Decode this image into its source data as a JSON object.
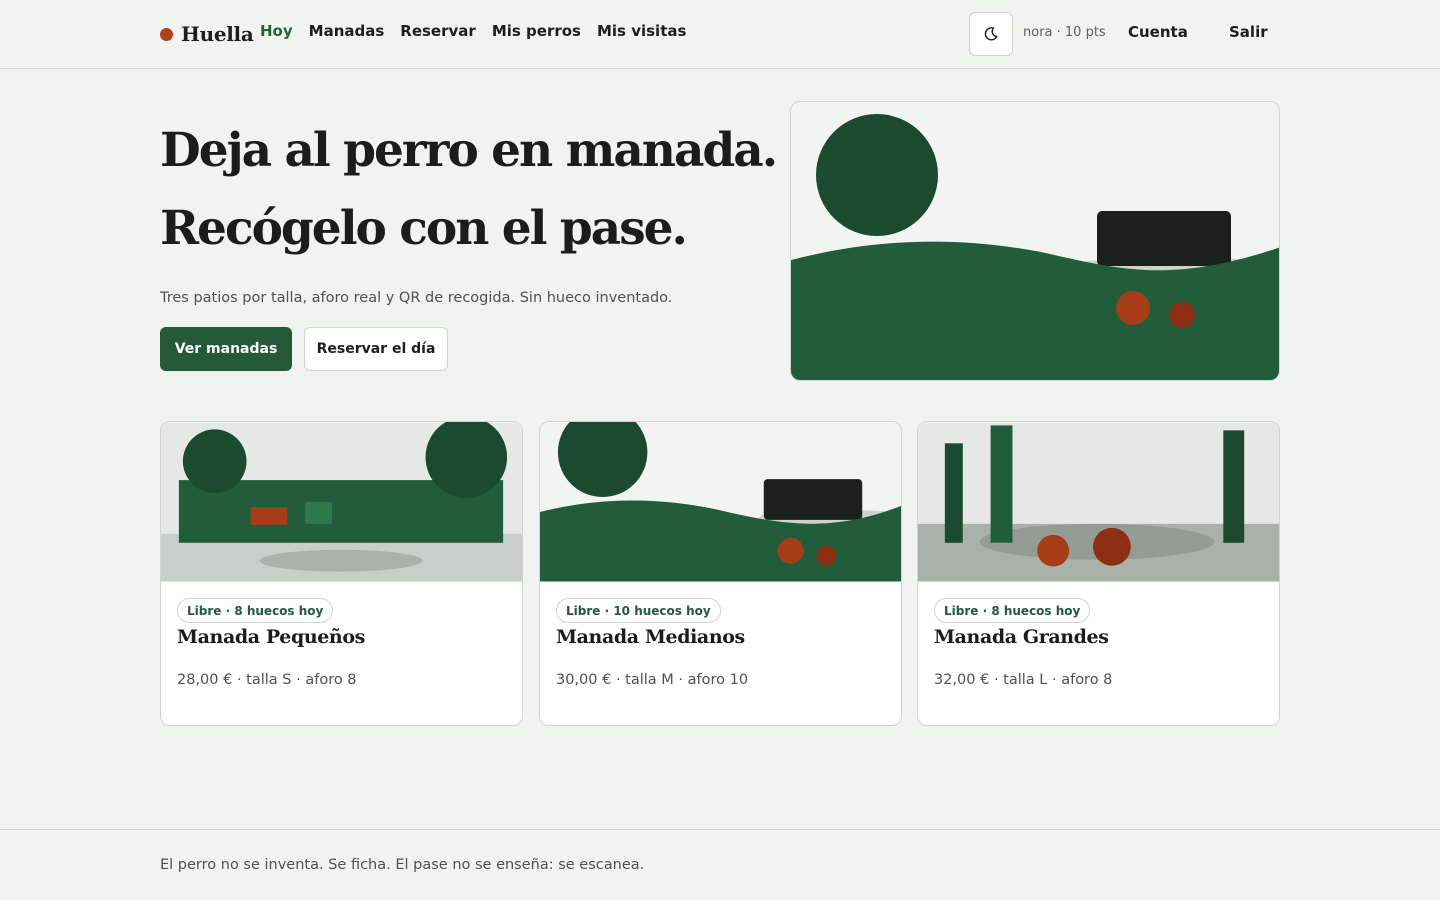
{
  "header": {
    "brand": "Huella",
    "nav": [
      "Hoy",
      "Manadas",
      "Reservar",
      "Mis perros",
      "Mis visitas"
    ],
    "active_nav": "Hoy",
    "theme_icon": "moon-icon",
    "user_points": "nora · 10 pts",
    "account_label": "Cuenta",
    "logout_label": "Salir"
  },
  "hero": {
    "title_line1": "Deja al perro en manada.",
    "title_line2": "Recógelo con el pase.",
    "subtitle": "Tres patios por talla, aforo real y QR de recogida. Sin hueco inventado.",
    "primary_button": "Ver manadas",
    "secondary_button": "Reservar el día"
  },
  "cards": [
    {
      "badge": "Libre · 8 huecos hoy",
      "title": "Manada Pequeños",
      "meta": "28,00 € · talla S · aforo 8"
    },
    {
      "badge": "Libre · 10 huecos hoy",
      "title": "Manada Medianos",
      "meta": "30,00 € · talla M · aforo 10"
    },
    {
      "badge": "Libre · 8 huecos hoy",
      "title": "Manada Grandes",
      "meta": "32,00 € · talla L · aforo 8"
    }
  ],
  "footer": {
    "text": "El perro no se inventa. Se ficha. El pase no se enseña: se escanea."
  },
  "colors": {
    "accent": "#24593a",
    "brand_dot": "#b0401d",
    "background": "#f1f3f1"
  }
}
